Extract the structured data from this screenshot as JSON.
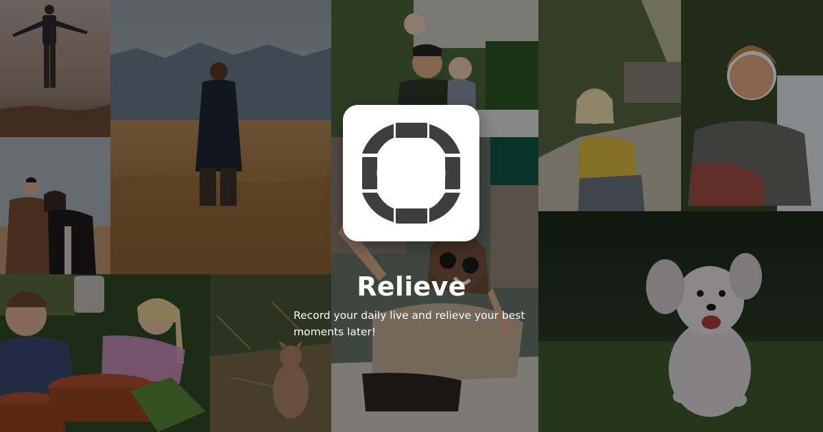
{
  "app": {
    "title": "Relieve",
    "tagline": "Record your daily live and relieve your best moments later!"
  },
  "colors": {
    "logo_background": "#ffffff",
    "logo_segments": "#3d3f3e",
    "logo_center": "#ffffff",
    "scrim": "rgba(0,0,0,0.42)"
  },
  "photos": [
    "person-levitating-photo",
    "hiker-in-field-photo",
    "family-smiling-photo",
    "sunlit-woman-photo",
    "laughing-woman-photo",
    "couple-photo",
    "woman-sunglasses-photo",
    "gardening-family-photo",
    "squirrel-photo",
    "running-dog-photo"
  ]
}
